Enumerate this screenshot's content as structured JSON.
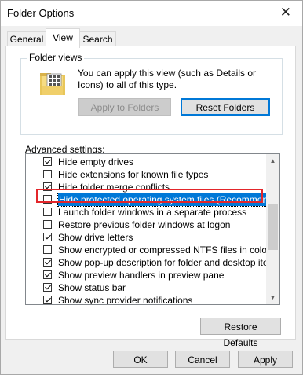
{
  "window": {
    "title": "Folder Options",
    "close_glyph": "✕"
  },
  "tabs": [
    {
      "label": "General"
    },
    {
      "label": "View",
      "active": true
    },
    {
      "label": "Search"
    }
  ],
  "folder_views": {
    "group_label": "Folder views",
    "description": "You can apply this view (such as Details or Icons) to all of this type.",
    "apply_label": "Apply to Folders",
    "reset_label": "Reset Folders"
  },
  "advanced": {
    "label": "Advanced settings:",
    "items": [
      {
        "label": "Hide empty drives",
        "checked": true
      },
      {
        "label": "Hide extensions for known file types",
        "checked": false
      },
      {
        "label": "Hide folder merge conflicts",
        "checked": true
      },
      {
        "label": "Hide protected operating system files (Recommended)",
        "checked": false,
        "selected": true
      },
      {
        "label": "Launch folder windows in a separate process",
        "checked": false
      },
      {
        "label": "Restore previous folder windows at logon",
        "checked": false
      },
      {
        "label": "Show drive letters",
        "checked": true
      },
      {
        "label": "Show encrypted or compressed NTFS files in color",
        "checked": false
      },
      {
        "label": "Show pop-up description for folder and desktop items",
        "checked": true
      },
      {
        "label": "Show preview handlers in preview pane",
        "checked": true
      },
      {
        "label": "Show status bar",
        "checked": true
      },
      {
        "label": "Show sync provider notifications",
        "checked": true
      }
    ],
    "restore_label": "Restore Defaults"
  },
  "footer": {
    "ok_label": "OK",
    "cancel_label": "Cancel",
    "apply_label": "Apply"
  },
  "colors": {
    "selection": "#0078d7",
    "highlight_border": "#e3262b"
  }
}
